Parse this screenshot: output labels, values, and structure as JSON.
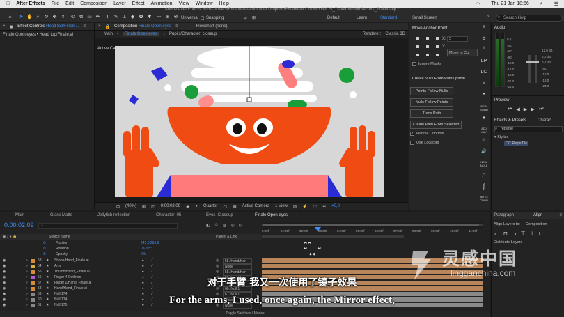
{
  "menubar": {
    "app": "After Effects",
    "items": [
      "File",
      "Edit",
      "Composition",
      "Layer",
      "Effect",
      "Animation",
      "View",
      "Window",
      "Help"
    ],
    "clock": "Thu 21 Jan 18:56"
  },
  "window_title": "Adobe After Effects 2020 - /Users/Emanuele/Antimatter Dropbox/Emanuele Colombo/MOS_Trailer/MotionSecrets_Trailer.aep *",
  "toolbar": {
    "universal": "Universal",
    "snapping": "Snapping",
    "workspaces": [
      "Default",
      "Learn",
      "Standard",
      "Small Screen"
    ],
    "search": "Search Help"
  },
  "left_panel": {
    "tab": "Effect Controls",
    "tab_link": "Head top/Finale...",
    "breadcrumb": "Finale Open eyes • Head top/Finale.ai"
  },
  "comp_panel": {
    "tab": "Composition",
    "tab_link": "Finale Open eyes",
    "flowchart": "Flowchart (none)",
    "subtabs": [
      "Main",
      "Finale Open eyes",
      "Pupils/Character_closeup"
    ],
    "renderer": "Renderer:",
    "renderer_val": "Classic 3D",
    "active_camera": "Active Camera",
    "zoom": "(40%)",
    "timecode": "0:00:02:09",
    "quality": "Quarter",
    "camera": "Active Camera",
    "view": "1 View",
    "exposure": "+0,0"
  },
  "anchor_panel": {
    "title": "Move Anchor Point",
    "x_label": "X:",
    "x_value": "5",
    "y_label": "Y:",
    "move_btn": "Move to Cur",
    "ignore_masks": "Ignore Masks"
  },
  "nulls_panel": {
    "title": "Create Nulls From Paths.jsxbin",
    "buttons": [
      "Points Follow Nulls",
      "Nulls Follow Points",
      "Trace Path",
      "Create Path From Selected"
    ],
    "handle_controls": "Handle Controls",
    "use_locators": "Use Locators"
  },
  "icon_column": [
    "LP",
    "LC"
  ],
  "audio": {
    "title": "Audio",
    "left_vals": [
      "0,0",
      "-3,0",
      "-6,0",
      "-9,0",
      "-12,0",
      "-15,0",
      "-18,0",
      "-21,0",
      "-24,0"
    ],
    "right_vals": [
      "12,0 dB",
      "6,0 dB",
      "0,0 dB",
      "-6,0",
      "-12,0",
      "-18,0",
      "-24,0"
    ]
  },
  "preview": {
    "title": "Preview"
  },
  "effects": {
    "title": "Effects & Presets",
    "tab2": "Charac",
    "search": "repetile",
    "category": "Stylize",
    "result": "CC RepeTile"
  },
  "timeline": {
    "tabs": [
      "Main",
      "Glass Matte",
      "Jellyfish reflection",
      "Character_05",
      "Eyes_Closeup",
      "Finale Open eyes"
    ],
    "timecode": "0:00:02:09",
    "col_source": "Source Name",
    "col_parent": "Parent & Link",
    "props": [
      {
        "name": "Position",
        "value": "241,8,285,9"
      },
      {
        "name": "Rotation",
        "value": "0x-8,5°"
      },
      {
        "name": "Opacity",
        "value": "0%"
      }
    ],
    "layers": [
      {
        "num": "53",
        "name": "Shape/Hand_Finale.ai",
        "parent": "58. Hand/Han"
      },
      {
        "num": "54",
        "name": "Arm",
        "parent": "None"
      },
      {
        "num": "55",
        "name": "Thumb/Hand_Finale.ai",
        "parent": "58. Hand/Han"
      },
      {
        "num": "56",
        "name": "Finger 4 Outlines",
        "parent": "58. Hand/Han"
      },
      {
        "num": "57",
        "name": "Finger 1/Hand_Finale.ai",
        "parent": "58. Hand/Han"
      },
      {
        "num": "58",
        "name": "Hand/Hand_Finale.ai",
        "parent": "60. Null 1"
      },
      {
        "num": "59",
        "name": "Null 174",
        "parent": "61. Null 1"
      },
      {
        "num": "60",
        "name": "Null 174",
        "parent": "None"
      },
      {
        "num": "61",
        "name": "Null 175",
        "parent": "None"
      }
    ],
    "ruler": [
      "0:00f",
      "01:00f",
      "02:00f",
      "03:00f",
      "04:00f",
      "05:00f",
      "06:00f",
      "07:00f",
      "08:00f",
      "09:00f",
      "10:00f",
      "11:00f"
    ],
    "footer": "Toggle Switches / Modes"
  },
  "align": {
    "tabs": [
      "Paragraph",
      "Align"
    ],
    "align_to": "Align Layers to:",
    "align_val": "Composition",
    "distribute": "Distribute Layers"
  },
  "subtitle": {
    "cn": "对于手臂 我又一次使用了镜子效果",
    "en": "For the arms, I used, once again, the Mirror effect,"
  },
  "watermark": {
    "cn": "灵感中国",
    "en": "lingganchina.com"
  },
  "colors": {
    "accent": "#3f8ef5",
    "character_orange": "#f14b14",
    "canvas_bg": "#d7d7d7"
  }
}
